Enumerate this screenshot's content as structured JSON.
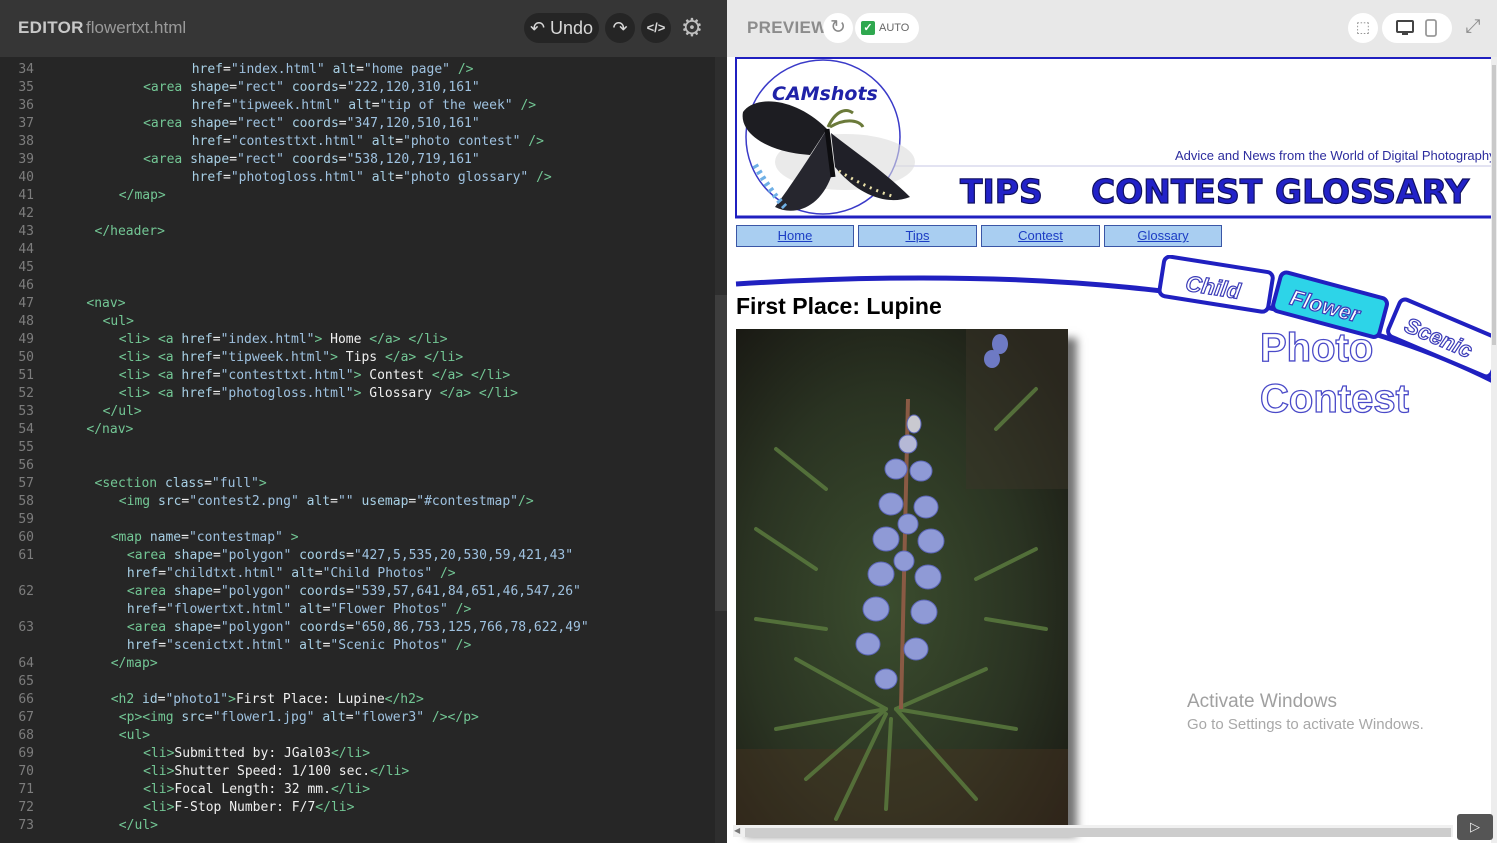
{
  "editor": {
    "title": "EDITOR",
    "filename": "flowertxt.html",
    "undo_label": "↶ Undo",
    "redo_icon": "↷",
    "code_icon": "</>",
    "gear_icon": "⚙"
  },
  "code_lines": [
    {
      "n": "34",
      "i": 17,
      "t": [
        [
          "at",
          "href"
        ],
        [
          "tx",
          "="
        ],
        [
          "st",
          "\"index.html\""
        ],
        [
          "tx",
          " "
        ],
        [
          "at",
          "alt"
        ],
        [
          "tx",
          "="
        ],
        [
          "st",
          "\"home page\""
        ],
        [
          "tx",
          " "
        ],
        [
          "tg",
          "/>"
        ]
      ]
    },
    {
      "n": "35",
      "i": 11,
      "t": [
        [
          "tg",
          "<area"
        ],
        [
          "tx",
          " "
        ],
        [
          "at",
          "shape"
        ],
        [
          "tx",
          "="
        ],
        [
          "st",
          "\"rect\""
        ],
        [
          "tx",
          " "
        ],
        [
          "at",
          "coords"
        ],
        [
          "tx",
          "="
        ],
        [
          "st",
          "\"222,120,310,161\""
        ]
      ]
    },
    {
      "n": "36",
      "i": 17,
      "t": [
        [
          "at",
          "href"
        ],
        [
          "tx",
          "="
        ],
        [
          "st",
          "\"tipweek.html\""
        ],
        [
          "tx",
          " "
        ],
        [
          "at",
          "alt"
        ],
        [
          "tx",
          "="
        ],
        [
          "st",
          "\"tip of the week\""
        ],
        [
          "tx",
          " "
        ],
        [
          "tg",
          "/>"
        ]
      ]
    },
    {
      "n": "37",
      "i": 11,
      "t": [
        [
          "tg",
          "<area"
        ],
        [
          "tx",
          " "
        ],
        [
          "at",
          "shape"
        ],
        [
          "tx",
          "="
        ],
        [
          "st",
          "\"rect\""
        ],
        [
          "tx",
          " "
        ],
        [
          "at",
          "coords"
        ],
        [
          "tx",
          "="
        ],
        [
          "st",
          "\"347,120,510,161\""
        ]
      ]
    },
    {
      "n": "38",
      "i": 17,
      "t": [
        [
          "at",
          "href"
        ],
        [
          "tx",
          "="
        ],
        [
          "st",
          "\"contesttxt.html\""
        ],
        [
          "tx",
          " "
        ],
        [
          "at",
          "alt"
        ],
        [
          "tx",
          "="
        ],
        [
          "st",
          "\"photo contest\""
        ],
        [
          "tx",
          " "
        ],
        [
          "tg",
          "/>"
        ]
      ]
    },
    {
      "n": "39",
      "i": 11,
      "t": [
        [
          "tg",
          "<area"
        ],
        [
          "tx",
          " "
        ],
        [
          "at",
          "shape"
        ],
        [
          "tx",
          "="
        ],
        [
          "st",
          "\"rect\""
        ],
        [
          "tx",
          " "
        ],
        [
          "at",
          "coords"
        ],
        [
          "tx",
          "="
        ],
        [
          "st",
          "\"538,120,719,161\""
        ]
      ]
    },
    {
      "n": "40",
      "i": 17,
      "t": [
        [
          "at",
          "href"
        ],
        [
          "tx",
          "="
        ],
        [
          "st",
          "\"photogloss.html\""
        ],
        [
          "tx",
          " "
        ],
        [
          "at",
          "alt"
        ],
        [
          "tx",
          "="
        ],
        [
          "st",
          "\"photo glossary\""
        ],
        [
          "tx",
          " "
        ],
        [
          "tg",
          "/>"
        ]
      ]
    },
    {
      "n": "41",
      "i": 8,
      "t": [
        [
          "tg",
          "</map>"
        ]
      ]
    },
    {
      "n": "42",
      "i": 0,
      "t": []
    },
    {
      "n": "43",
      "i": 5,
      "t": [
        [
          "tg",
          "</header>"
        ]
      ]
    },
    {
      "n": "44",
      "i": 0,
      "t": []
    },
    {
      "n": "45",
      "i": 0,
      "t": []
    },
    {
      "n": "46",
      "i": 0,
      "t": []
    },
    {
      "n": "47",
      "i": 4,
      "t": [
        [
          "tg",
          "<nav>"
        ]
      ]
    },
    {
      "n": "48",
      "i": 6,
      "t": [
        [
          "tg",
          "<ul>"
        ]
      ]
    },
    {
      "n": "49",
      "i": 8,
      "t": [
        [
          "tg",
          "<li>"
        ],
        [
          "tx",
          " "
        ],
        [
          "tg",
          "<a"
        ],
        [
          "tx",
          " "
        ],
        [
          "at",
          "href"
        ],
        [
          "tx",
          "="
        ],
        [
          "st",
          "\"index.html\""
        ],
        [
          "tg",
          ">"
        ],
        [
          "tx",
          " Home "
        ],
        [
          "tg",
          "</a>"
        ],
        [
          "tx",
          " "
        ],
        [
          "tg",
          "</li>"
        ]
      ]
    },
    {
      "n": "50",
      "i": 8,
      "t": [
        [
          "tg",
          "<li>"
        ],
        [
          "tx",
          " "
        ],
        [
          "tg",
          "<a"
        ],
        [
          "tx",
          " "
        ],
        [
          "at",
          "href"
        ],
        [
          "tx",
          "="
        ],
        [
          "st",
          "\"tipweek.html\""
        ],
        [
          "tg",
          ">"
        ],
        [
          "tx",
          " Tips "
        ],
        [
          "tg",
          "</a>"
        ],
        [
          "tx",
          " "
        ],
        [
          "tg",
          "</li>"
        ]
      ]
    },
    {
      "n": "51",
      "i": 8,
      "t": [
        [
          "tg",
          "<li>"
        ],
        [
          "tx",
          " "
        ],
        [
          "tg",
          "<a"
        ],
        [
          "tx",
          " "
        ],
        [
          "at",
          "href"
        ],
        [
          "tx",
          "="
        ],
        [
          "st",
          "\"contesttxt.html\""
        ],
        [
          "tg",
          ">"
        ],
        [
          "tx",
          " Contest "
        ],
        [
          "tg",
          "</a>"
        ],
        [
          "tx",
          " "
        ],
        [
          "tg",
          "</li>"
        ]
      ]
    },
    {
      "n": "52",
      "i": 8,
      "t": [
        [
          "tg",
          "<li>"
        ],
        [
          "tx",
          " "
        ],
        [
          "tg",
          "<a"
        ],
        [
          "tx",
          " "
        ],
        [
          "at",
          "href"
        ],
        [
          "tx",
          "="
        ],
        [
          "st",
          "\"photogloss.html\""
        ],
        [
          "tg",
          ">"
        ],
        [
          "tx",
          " Glossary "
        ],
        [
          "tg",
          "</a>"
        ],
        [
          "tx",
          " "
        ],
        [
          "tg",
          "</li>"
        ]
      ]
    },
    {
      "n": "53",
      "i": 6,
      "t": [
        [
          "tg",
          "</ul>"
        ]
      ]
    },
    {
      "n": "54",
      "i": 4,
      "t": [
        [
          "tg",
          "</nav>"
        ]
      ]
    },
    {
      "n": "55",
      "i": 0,
      "t": []
    },
    {
      "n": "56",
      "i": 0,
      "t": []
    },
    {
      "n": "57",
      "i": 5,
      "t": [
        [
          "tg",
          "<section"
        ],
        [
          "tx",
          " "
        ],
        [
          "at",
          "class"
        ],
        [
          "tx",
          "="
        ],
        [
          "st",
          "\"full\""
        ],
        [
          "tg",
          ">"
        ]
      ]
    },
    {
      "n": "58",
      "i": 8,
      "t": [
        [
          "tg",
          "<img"
        ],
        [
          "tx",
          " "
        ],
        [
          "at",
          "src"
        ],
        [
          "tx",
          "="
        ],
        [
          "st",
          "\"contest2.png\""
        ],
        [
          "tx",
          " "
        ],
        [
          "at",
          "alt"
        ],
        [
          "tx",
          "="
        ],
        [
          "st",
          "\"\""
        ],
        [
          "tx",
          " "
        ],
        [
          "at",
          "usemap"
        ],
        [
          "tx",
          "="
        ],
        [
          "st",
          "\"#contestmap\""
        ],
        [
          "tg",
          "/>"
        ]
      ]
    },
    {
      "n": "59",
      "i": 0,
      "t": []
    },
    {
      "n": "60",
      "i": 7,
      "t": [
        [
          "tg",
          "<map"
        ],
        [
          "tx",
          " "
        ],
        [
          "at",
          "name"
        ],
        [
          "tx",
          "="
        ],
        [
          "st",
          "\"contestmap\""
        ],
        [
          "tx",
          " "
        ],
        [
          "tg",
          ">"
        ]
      ]
    },
    {
      "n": "61",
      "i": 9,
      "t": [
        [
          "tg",
          "<area"
        ],
        [
          "tx",
          " "
        ],
        [
          "at",
          "shape"
        ],
        [
          "tx",
          "="
        ],
        [
          "st",
          "\"polygon\""
        ],
        [
          "tx",
          " "
        ],
        [
          "at",
          "coords"
        ],
        [
          "tx",
          "="
        ],
        [
          "st",
          "\"427,5,535,20,530,59,421,43\""
        ]
      ]
    },
    {
      "n": "",
      "i": 9,
      "t": [
        [
          "at",
          "href"
        ],
        [
          "tx",
          "="
        ],
        [
          "st",
          "\"childtxt.html\""
        ],
        [
          "tx",
          " "
        ],
        [
          "at",
          "alt"
        ],
        [
          "tx",
          "="
        ],
        [
          "st",
          "\"Child Photos\""
        ],
        [
          "tx",
          " "
        ],
        [
          "tg",
          "/>"
        ]
      ]
    },
    {
      "n": "62",
      "i": 9,
      "t": [
        [
          "tg",
          "<area"
        ],
        [
          "tx",
          " "
        ],
        [
          "at",
          "shape"
        ],
        [
          "tx",
          "="
        ],
        [
          "st",
          "\"polygon\""
        ],
        [
          "tx",
          " "
        ],
        [
          "at",
          "coords"
        ],
        [
          "tx",
          "="
        ],
        [
          "st",
          "\"539,57,641,84,651,46,547,26\""
        ]
      ]
    },
    {
      "n": "",
      "i": 9,
      "t": [
        [
          "at",
          "href"
        ],
        [
          "tx",
          "="
        ],
        [
          "st",
          "\"flowertxt.html\""
        ],
        [
          "tx",
          " "
        ],
        [
          "at",
          "alt"
        ],
        [
          "tx",
          "="
        ],
        [
          "st",
          "\"Flower Photos\""
        ],
        [
          "tx",
          " "
        ],
        [
          "tg",
          "/>"
        ]
      ]
    },
    {
      "n": "63",
      "i": 9,
      "t": [
        [
          "tg",
          "<area"
        ],
        [
          "tx",
          " "
        ],
        [
          "at",
          "shape"
        ],
        [
          "tx",
          "="
        ],
        [
          "st",
          "\"polygon\""
        ],
        [
          "tx",
          " "
        ],
        [
          "at",
          "coords"
        ],
        [
          "tx",
          "="
        ],
        [
          "st",
          "\"650,86,753,125,766,78,622,49\""
        ]
      ]
    },
    {
      "n": "",
      "i": 9,
      "t": [
        [
          "at",
          "href"
        ],
        [
          "tx",
          "="
        ],
        [
          "st",
          "\"scenictxt.html\""
        ],
        [
          "tx",
          " "
        ],
        [
          "at",
          "alt"
        ],
        [
          "tx",
          "="
        ],
        [
          "st",
          "\"Scenic Photos\""
        ],
        [
          "tx",
          " "
        ],
        [
          "tg",
          "/>"
        ]
      ]
    },
    {
      "n": "64",
      "i": 7,
      "t": [
        [
          "tg",
          "</map>"
        ]
      ]
    },
    {
      "n": "65",
      "i": 0,
      "t": []
    },
    {
      "n": "66",
      "i": 7,
      "t": [
        [
          "tg",
          "<h2"
        ],
        [
          "tx",
          " "
        ],
        [
          "at",
          "id"
        ],
        [
          "tx",
          "="
        ],
        [
          "st",
          "\"photo1\""
        ],
        [
          "tg",
          ">"
        ],
        [
          "tx",
          "First Place: Lupine"
        ],
        [
          "tg",
          "</h2>"
        ]
      ]
    },
    {
      "n": "67",
      "i": 8,
      "t": [
        [
          "tg",
          "<p><img"
        ],
        [
          "tx",
          " "
        ],
        [
          "at",
          "src"
        ],
        [
          "tx",
          "="
        ],
        [
          "st",
          "\"flower1.jpg\""
        ],
        [
          "tx",
          " "
        ],
        [
          "at",
          "alt"
        ],
        [
          "tx",
          "="
        ],
        [
          "st",
          "\"flower3\""
        ],
        [
          "tx",
          " "
        ],
        [
          "tg",
          "/></p>"
        ]
      ]
    },
    {
      "n": "68",
      "i": 8,
      "t": [
        [
          "tg",
          "<ul>"
        ]
      ]
    },
    {
      "n": "69",
      "i": 11,
      "t": [
        [
          "tg",
          "<li>"
        ],
        [
          "tx",
          "Submitted by: JGal03"
        ],
        [
          "tg",
          "</li>"
        ]
      ]
    },
    {
      "n": "70",
      "i": 11,
      "t": [
        [
          "tg",
          "<li>"
        ],
        [
          "tx",
          "Shutter Speed: 1/100 sec."
        ],
        [
          "tg",
          "</li>"
        ]
      ]
    },
    {
      "n": "71",
      "i": 11,
      "t": [
        [
          "tg",
          "<li>"
        ],
        [
          "tx",
          "Focal Length: 32 mm."
        ],
        [
          "tg",
          "</li>"
        ]
      ]
    },
    {
      "n": "72",
      "i": 11,
      "t": [
        [
          "tg",
          "<li>"
        ],
        [
          "tx",
          "F-Stop Number: F/7"
        ],
        [
          "tg",
          "</li>"
        ]
      ]
    },
    {
      "n": "73",
      "i": 8,
      "t": [
        [
          "tg",
          "</ul>"
        ]
      ]
    }
  ],
  "preview": {
    "title": "PREVIEW",
    "refresh_icon": "↻",
    "auto_label": "AUTO",
    "auto_checked": "✓",
    "select_icon": "⬚",
    "desktop_icon": "🖥",
    "mobile_icon": "▯",
    "expand_icon": "⤢",
    "console_icon": "▷"
  },
  "site": {
    "logo_text": "CAMshots",
    "tagline": "Advice and News from the World of Digital Photography",
    "banner_links": [
      "TIPS",
      "CONTEST",
      "GLOSSARY"
    ],
    "nav": [
      "Home",
      "Tips",
      "Contest",
      "Glossary"
    ],
    "tabs": [
      "Child",
      "Flower",
      "Scenic"
    ],
    "contest_title": [
      "Photo",
      "Contest"
    ],
    "heading": "First Place: Lupine"
  },
  "colors": {
    "site_blue": "#2020c0",
    "nav_fill": "#a9cef1",
    "tab_active": "#2dd4e8",
    "tab_text": "#3b3bb8"
  },
  "overlay": {
    "activate_title": "Activate Windows",
    "activate_sub": "Go to Settings to activate Windows."
  }
}
